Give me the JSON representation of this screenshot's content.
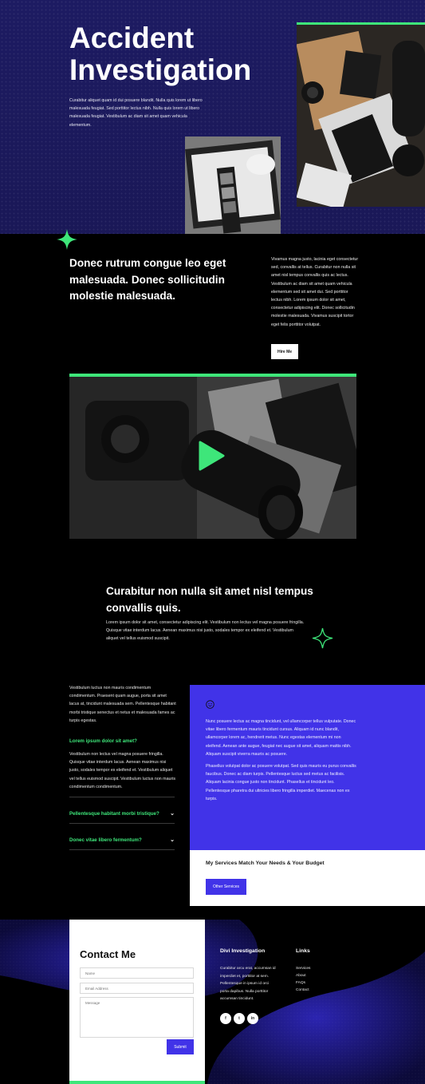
{
  "hero": {
    "title": "Accident Investigation",
    "text": "Curabitur aliquet quam id dui posuere blandit. Nulla quis lorem ut libero malesuada feugiat. Sed porttitor lectus nibh. Nulla quis lorem ut libero malesuada feugiat. Vestibulum ac diam sit amet quam vehicula elementum."
  },
  "intro": {
    "heading": "Donec rutrum congue leo eget malesuada. Donec sollicitudin molestie malesuada.",
    "text": "Vivamus magna justo, lacinia eget consectetur sed, convallis at tellus. Curabitur non nulla sit amet nisl tempus convallis quis ac lectus. Vestibulum ac diam sit amet quam vehicula elementum sed sit amet dui. Sed porttitor lectus nibh. Lorem ipsum dolor sit amet, consectetur adipiscing elit. Donec sollicitudin molestie malesuada. Vivamus suscipit tortor eget felis porttitor volutpat.",
    "button": "Hire Me"
  },
  "quote": {
    "heading": "Curabitur non nulla sit amet nisl tempus convallis quis.",
    "text": "Lorem ipsum dolor sit amet, consectetur adipiscing elit. Vestibulum non lectus vel magna posuere fringilla. Quisque vitae interdum lacus. Aenean maximus nisi justo, sodales tempor ex eleifend et. Vestibulum aliquet vel tellus euismod suscipit."
  },
  "faq": {
    "text1": "Vestibulum luctus non mauris condimentum condimentum. Praesent quam augue, porta sit amet lacus at, tincidunt malesuada sem. Pellentesque habitant morbi tristique senectus et netus et malesuada fames ac turpis egestas.",
    "subheading": "Lorem ipsum dolor sit amet?",
    "text2": "Vestibulum non lectus vel magna posuere fringilla. Quisque vitae interdum lacus. Aenean maximus nisi justo, sodales tempor ex eleifend et. Vestibulum aliquet vel tellus euismod suscipit. Vestibulum luctus non mauris condimentum condimentum.",
    "questions": [
      "Pellentesque habitant morbi tristique?",
      "Donec vitae libero fermentum?"
    ]
  },
  "blue_panel": {
    "text1": "Nunc posuere lectus ac magna tincidunt, vel ullamcorper tellus vulputate. Donec vitae libero fermentum mauris tincidunt cursus. Aliquam id nunc blandit, ullamcorper lorem ac, hendrerit metus. Nunc egestas elementum mi non eleifend. Aenean ante augue, feugiat nec augue sit amet, aliquam mattis nibh. Aliquam suscipit viverra mauris ac posuere.",
    "text2": "Phasellus volutpat dolor ac posuere volutpat. Sed quis mauris eu purus convallis faucibus. Donec ac diam turpis. Pellentesque luctus sed metus ac facilisis. Aliquam lacinia congue justo non tincidunt. Phasellus et tincidunt leo. Pellentesque pharetra dui ultricies libero fringilla imperdiet. Maecenas non ex turpis."
  },
  "services": {
    "title": "My Services Match Your Needs & Your Budget",
    "button": "Other Services"
  },
  "contact": {
    "title": "Contact Me",
    "name_placeholder": "Name",
    "email_placeholder": "Email Address",
    "message_placeholder": "Message",
    "submit": "Submit"
  },
  "footer": {
    "brand_title": "Divi Investigation",
    "brand_text": "Curabitur arcu erat, accumsan id imperdiet et, porttitor at sem. Pellentesque in ipsum id orci porta dapibus. Nulla porttitor accumsan tincidunt.",
    "links_title": "Links",
    "links": [
      "Services",
      "About",
      "FAQs",
      "Contact"
    ],
    "social": [
      "f",
      "t",
      "in"
    ]
  },
  "colors": {
    "accent_green": "#3ee67a",
    "brand_blue": "#4133e8",
    "hero_navy": "#1c1a5c"
  }
}
